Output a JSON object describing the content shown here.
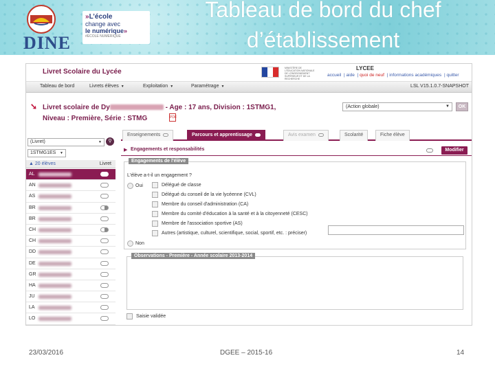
{
  "slide": {
    "title_line1": "Tableau de bord du chef",
    "title_line2": "d’établissement",
    "logo_dine": "DINE",
    "logo_ecole": {
      "arrow_left": "»",
      "line1": "L’école",
      "line2": "change avec",
      "line3": "le numérique",
      "arrow_right": "»",
      "line4": "#ECOLE NUMERIQUE"
    },
    "footer_date": "23/03/2016",
    "footer_center": "DGEE – 2015-16",
    "footer_page": "14"
  },
  "app": {
    "title": "Livret Scolaire du Lycée",
    "lycee_label": "LYCEE",
    "ministry_text": "MINISTÈRE DE L'ÉDUCATION NATIONALE DE L'ENSEIGNEMENT SUPÉRIEUR ET DE LA RECHERCHE",
    "top_links": [
      "accueil",
      "aide",
      "quoi de neuf",
      "informations académiques",
      "quitter"
    ],
    "menu": [
      "Tableau de bord",
      "Livrets élèves",
      "Exploitation",
      "Paramétrage"
    ],
    "version": "LSL V15.1.0.7-SNAPSHOT",
    "student": {
      "prefix": "Livret scolaire de Dy",
      "details": " - Age : 17 ans, Division : 1STMG1,",
      "line2": "Niveau : Première, Série : STMG"
    },
    "pdf_label": "PDF",
    "action_select": "(Action globale)",
    "ok_label": "OK",
    "left": {
      "level": "(Livret)",
      "class": "1STMG1ES",
      "count": "▲ 20 élèves",
      "col_header": "Livret",
      "students": [
        {
          "prefix": "AL",
          "selected": true,
          "toggle": "full"
        },
        {
          "prefix": "AN",
          "selected": false,
          "toggle": "empty"
        },
        {
          "prefix": "AS",
          "selected": false,
          "toggle": "empty"
        },
        {
          "prefix": "BR",
          "selected": false,
          "toggle": "half"
        },
        {
          "prefix": "BR",
          "selected": false,
          "toggle": "empty"
        },
        {
          "prefix": "CH",
          "selected": false,
          "toggle": "half"
        },
        {
          "prefix": "CH",
          "selected": false,
          "toggle": "empty"
        },
        {
          "prefix": "DD",
          "selected": false,
          "toggle": "empty"
        },
        {
          "prefix": "DE",
          "selected": false,
          "toggle": "empty"
        },
        {
          "prefix": "GR",
          "selected": false,
          "toggle": "empty"
        },
        {
          "prefix": "HA",
          "selected": false,
          "toggle": "empty"
        },
        {
          "prefix": "JU",
          "selected": false,
          "toggle": "empty"
        },
        {
          "prefix": "LA",
          "selected": false,
          "toggle": "empty"
        },
        {
          "prefix": "LO",
          "selected": false,
          "toggle": "empty"
        }
      ]
    },
    "tabs": [
      {
        "label": "Enseignements",
        "state": "normal"
      },
      {
        "label": "Parcours et apprentissage",
        "state": "active"
      },
      {
        "label": "Avis examen",
        "state": "disabled"
      },
      {
        "label": "Scolarité",
        "state": "normal"
      },
      {
        "label": "Fiche élève",
        "state": "normal"
      }
    ],
    "section_title": "Engagements et responsabilités",
    "modify_label": "Modifier",
    "engagement": {
      "legend": "Engagements de l'élève",
      "question": "L'élève a-t-il un engagement ?",
      "yes": "Oui",
      "no": "Non",
      "options": [
        "Délégué de classe",
        "Délégué du conseil de la vie lycéenne (CVL)",
        "Membre du conseil d'administration (CA)",
        "Membre du comité d'éducation à la santé et à la citoyenneté (CESC)",
        "Membre de l'association sportive (AS)",
        "Autres (artistique, culturel, scientifique, social, sportif, etc. : préciser)"
      ]
    },
    "observations_legend": "Observations - Première - Année scolaire 2013-2014",
    "validated_label": "Saisie validée"
  },
  "colors": {
    "brand": "#8a1c52",
    "banner": "#9adce4",
    "title_text": "#ffffff"
  }
}
